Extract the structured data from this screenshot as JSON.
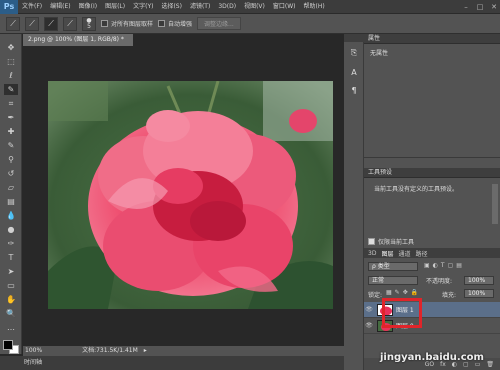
{
  "app": {
    "logo": "Ps"
  },
  "menubar": {
    "items": [
      "文件(F)",
      "编辑(E)",
      "图像(I)",
      "图层(L)",
      "文字(Y)",
      "选择(S)",
      "滤镜(T)",
      "3D(D)",
      "视图(V)",
      "窗口(W)",
      "帮助(H)"
    ],
    "window_controls": [
      "–",
      "□",
      "✕"
    ]
  },
  "options_bar": {
    "brush_size": "5",
    "sample_all_layers_label": "对所有图层取样",
    "auto_enhance_label": "自动增强",
    "refine_edge_label": "调整边缘..."
  },
  "document": {
    "tab_label": "2.png @ 100% (图层 1, RGB/8) *",
    "tab_close": "×"
  },
  "status": {
    "zoom": "100%",
    "doc_info": "文档:731.5K/1.41M"
  },
  "timeline": {
    "label": "时间轴"
  },
  "properties": {
    "title": "属性",
    "content": "无属性"
  },
  "tool_presets": {
    "title": "工具预设",
    "content": "当前工具没有定义的工具预设。",
    "current_only_label": "仅限当前工具"
  },
  "layers": {
    "tabs": [
      "3D",
      "图层",
      "通道",
      "路径"
    ],
    "kind_filter": "ρ 类型",
    "blend_mode": "正常",
    "opacity_label": "不透明度:",
    "opacity_value": "100%",
    "lock_label": "锁定:",
    "fill_label": "填充:",
    "fill_value": "100%",
    "rows": [
      {
        "name": "图层 1",
        "selected": true
      },
      {
        "name": "图层 0",
        "selected": false
      }
    ],
    "bottom_icons": [
      "GO",
      "fx",
      "◐",
      "▢",
      "▭",
      "🗑"
    ]
  },
  "watermark": "jingyan.baidu.com",
  "colors": {
    "highlight_red": "#e0242a",
    "panel_bg": "#535353",
    "selected_layer": "#5b6f8a"
  }
}
